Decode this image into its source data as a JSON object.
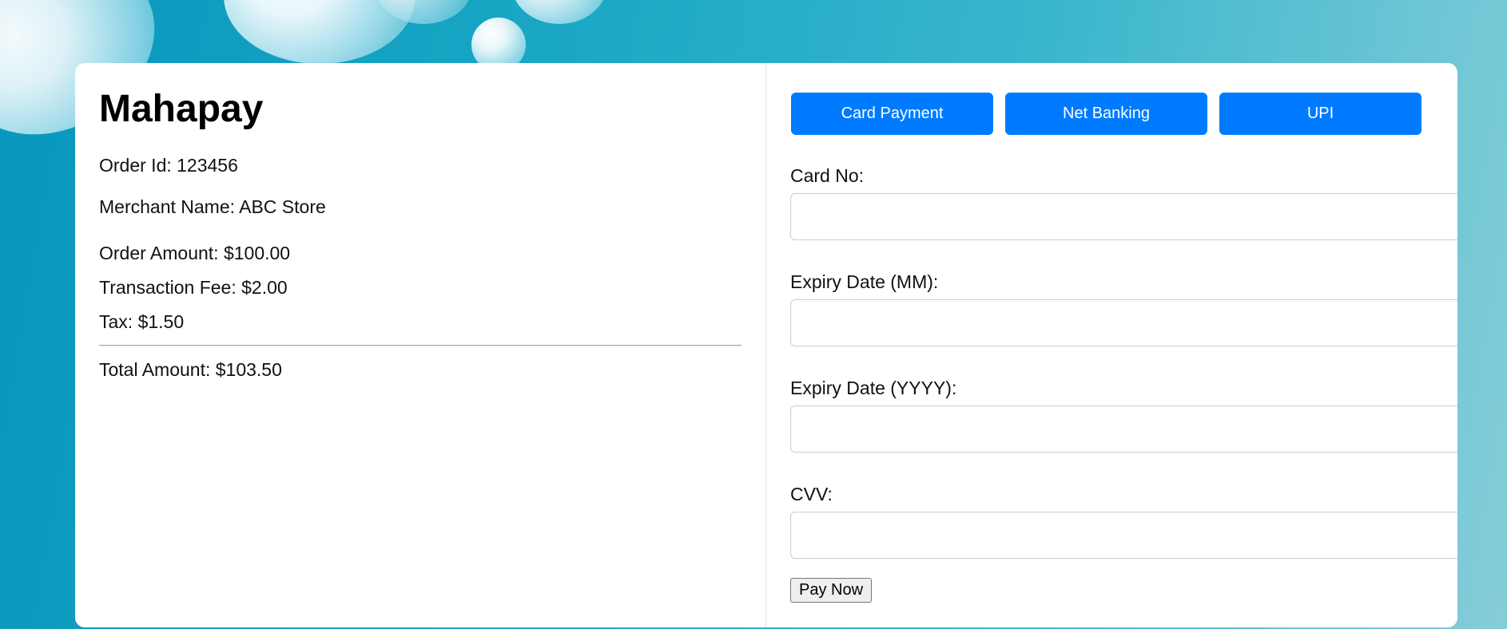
{
  "colors": {
    "tab_bg": "#007bff",
    "tab_text": "#ffffff",
    "card_bg": "#ffffff"
  },
  "summary": {
    "title": "Mahapay",
    "order_id": "Order Id: 123456",
    "merchant_name": "Merchant Name: ABC Store",
    "order_amount": "Order Amount: $100.00",
    "transaction_fee": "Transaction Fee: $2.00",
    "tax": "Tax: $1.50",
    "total_amount": "Total Amount: $103.50"
  },
  "tabs": [
    {
      "label": "Card Payment"
    },
    {
      "label": "Net Banking"
    },
    {
      "label": "UPI"
    }
  ],
  "form": {
    "card_no_label": "Card No:",
    "card_no_value": "",
    "expiry_mm_label": "Expiry Date (MM):",
    "expiry_mm_value": "",
    "expiry_yyyy_label": "Expiry Date (YYYY):",
    "expiry_yyyy_value": "",
    "cvv_label": "CVV:",
    "cvv_value": "",
    "pay_button": "Pay Now"
  }
}
